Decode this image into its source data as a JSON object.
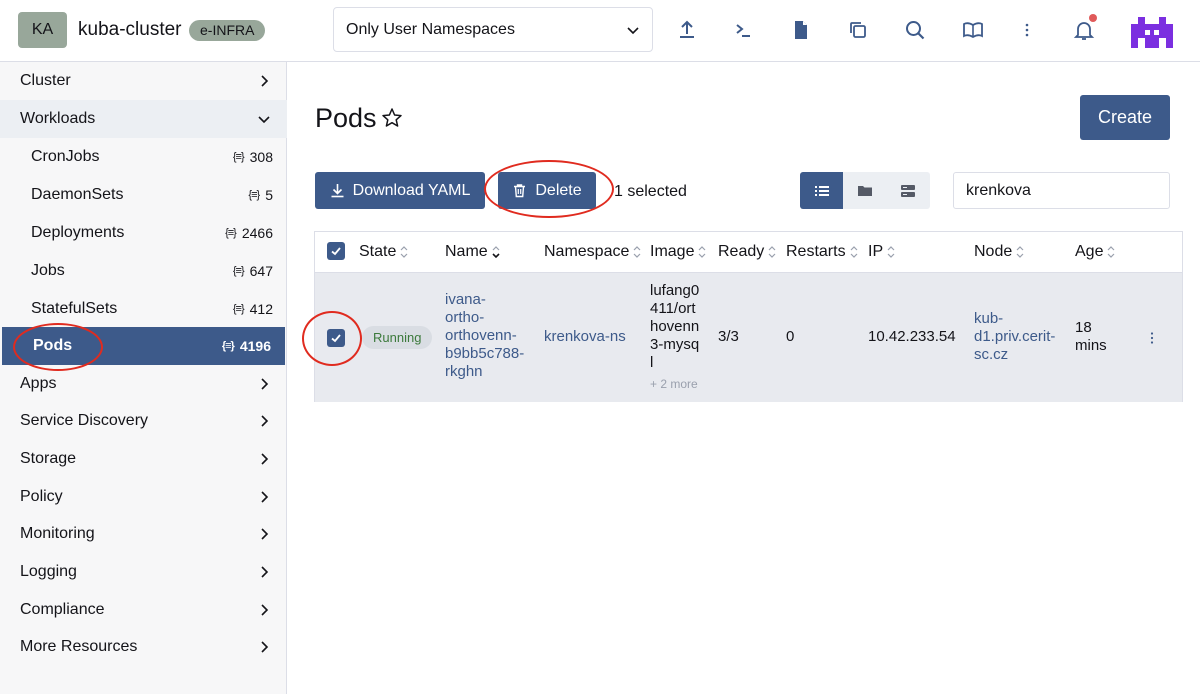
{
  "header": {
    "cluster_initials": "KA",
    "cluster_name": "kuba-cluster",
    "env_label": "e-INFRA",
    "namespace_filter": "Only User Namespaces"
  },
  "sidebar": {
    "groups": [
      {
        "label": "Cluster"
      },
      {
        "label": "Workloads"
      },
      {
        "label": "Apps"
      },
      {
        "label": "Service Discovery"
      },
      {
        "label": "Storage"
      },
      {
        "label": "Policy"
      },
      {
        "label": "Monitoring"
      },
      {
        "label": "Logging"
      },
      {
        "label": "Compliance"
      },
      {
        "label": "More Resources"
      }
    ],
    "workload_items": [
      {
        "label": "CronJobs",
        "count": "308"
      },
      {
        "label": "DaemonSets",
        "count": "5"
      },
      {
        "label": "Deployments",
        "count": "2466"
      },
      {
        "label": "Jobs",
        "count": "647"
      },
      {
        "label": "StatefulSets",
        "count": "412"
      },
      {
        "label": "Pods",
        "count": "4196"
      }
    ],
    "count_glyph": "{≡}"
  },
  "main": {
    "title": "Pods",
    "create_label": "Create",
    "download_label": "Download YAML",
    "delete_label": "Delete",
    "selected_text": "1 selected",
    "search_value": "krenkova"
  },
  "table": {
    "headers": [
      "State",
      "Name",
      "Namespace",
      "Image",
      "Ready",
      "Restarts",
      "IP",
      "Node",
      "Age"
    ],
    "row": {
      "state": "Running",
      "name": [
        "ivana-",
        "ortho-",
        "orthovenn-",
        "b9bb5c788-",
        "rkghn"
      ],
      "namespace": "krenkova-ns",
      "image": [
        "lufang0",
        "411/ort",
        "hovenn",
        "3-mysq",
        "l"
      ],
      "image_more": "+ 2 more",
      "ready": "3/3",
      "restarts": "0",
      "ip": "10.42.233.54",
      "node": [
        "kub-",
        "d1.priv.cerit-",
        "sc.cz"
      ],
      "age": [
        "18",
        "mins"
      ]
    }
  },
  "colors": {
    "primary": "#3d5a8a",
    "sidebar_bg": "#f7f7f8",
    "badge_bg": "#98a79a",
    "annotation": "#e02b1f"
  }
}
